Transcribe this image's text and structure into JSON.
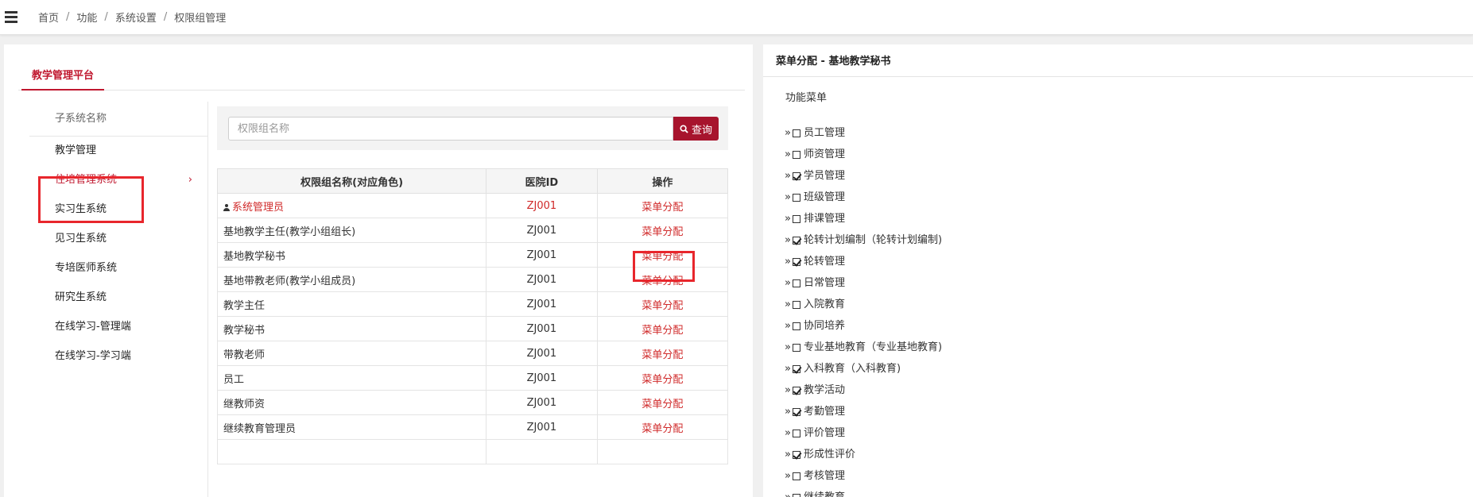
{
  "breadcrumb": [
    "首页",
    "功能",
    "系统设置",
    "权限组管理"
  ],
  "breadcrumb_separator": "/",
  "tab": {
    "label": "教学管理平台"
  },
  "subsystem": {
    "header": "子系统名称",
    "items": [
      {
        "label": "教学管理"
      },
      {
        "label": "住培管理系统",
        "active": true
      },
      {
        "label": "实习生系统"
      },
      {
        "label": "见习生系统"
      },
      {
        "label": "专培医师系统"
      },
      {
        "label": "研究生系统"
      },
      {
        "label": "在线学习-管理端"
      },
      {
        "label": "在线学习-学习端"
      }
    ],
    "chevron": "›"
  },
  "search": {
    "placeholder": "权限组名称",
    "button_label": "查询",
    "button_icon": "search-icon"
  },
  "table": {
    "headers": [
      "权限组名称(对应角色)",
      "医院ID",
      "操作"
    ],
    "rows": [
      {
        "name": "系统管理员",
        "hospital_id": "ZJ001",
        "action": "菜单分配"
      },
      {
        "name": "基地教学主任(教学小组组长)",
        "hospital_id": "ZJ001",
        "action": "菜单分配"
      },
      {
        "name": "基地教学秘书",
        "hospital_id": "ZJ001",
        "action": "菜单分配"
      },
      {
        "name": "基地带教老师(教学小组成员)",
        "hospital_id": "ZJ001",
        "action": "菜单分配"
      },
      {
        "name": "教学主任",
        "hospital_id": "ZJ001",
        "action": "菜单分配"
      },
      {
        "name": "教学秘书",
        "hospital_id": "ZJ001",
        "action": "菜单分配"
      },
      {
        "name": "带教老师",
        "hospital_id": "ZJ001",
        "action": "菜单分配"
      },
      {
        "name": "员工",
        "hospital_id": "ZJ001",
        "action": "菜单分配"
      },
      {
        "name": "继教师资",
        "hospital_id": "ZJ001",
        "action": "菜单分配"
      },
      {
        "name": "继续教育管理员",
        "hospital_id": "ZJ001",
        "action": "菜单分配"
      }
    ]
  },
  "menu_panel": {
    "title": "菜单分配 - 基地教学秘书",
    "root": "功能菜单",
    "items": [
      {
        "label": "员工管理",
        "checked": false
      },
      {
        "label": "师资管理",
        "checked": false
      },
      {
        "label": "学员管理",
        "checked": true
      },
      {
        "label": "班级管理",
        "checked": false
      },
      {
        "label": "排课管理",
        "checked": false
      },
      {
        "label": "轮转计划编制（轮转计划编制)",
        "checked": true
      },
      {
        "label": "轮转管理",
        "checked": true
      },
      {
        "label": "日常管理",
        "checked": false
      },
      {
        "label": "入院教育",
        "checked": false
      },
      {
        "label": "协同培养",
        "checked": false
      },
      {
        "label": "专业基地教育（专业基地教育)",
        "checked": false
      },
      {
        "label": "入科教育（入科教育)",
        "checked": true
      },
      {
        "label": "教学活动",
        "checked": true
      },
      {
        "label": "考勤管理",
        "checked": true
      },
      {
        "label": "评价管理",
        "checked": false
      },
      {
        "label": "形成性评价",
        "checked": true
      },
      {
        "label": "考核管理",
        "checked": false
      },
      {
        "label": "继续教育",
        "checked": false
      }
    ]
  },
  "colors": {
    "accent": "#c0182f",
    "button": "#a7142d",
    "link": "#d02a2a",
    "highlight": "#e8262c"
  }
}
